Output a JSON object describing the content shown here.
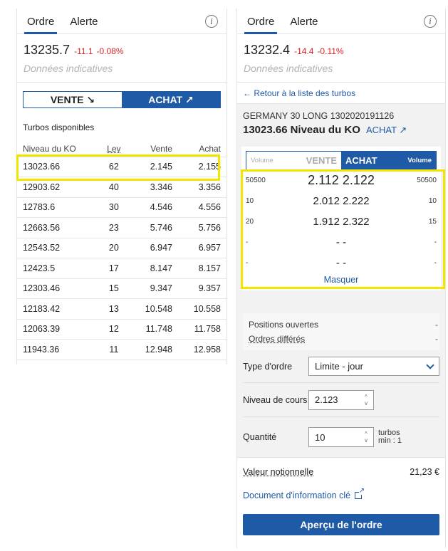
{
  "left": {
    "tabs": [
      "Ordre",
      "Alerte"
    ],
    "info_icon": "info-icon",
    "price": "13235.7",
    "change": "-11.1",
    "change_pct": "-0.08%",
    "indicative": "Données indicatives",
    "sell_label": "VENTE ↘",
    "buy_label": "ACHAT ↗",
    "section_title": "Turbos disponibles",
    "columns": [
      "Niveau du KO",
      "Lev",
      "Vente",
      "Achat"
    ],
    "rows": [
      [
        "13023.66",
        "62",
        "2.145",
        "2.155"
      ],
      [
        "12903.62",
        "40",
        "3.346",
        "3.356"
      ],
      [
        "12783.6",
        "30",
        "4.546",
        "4.556"
      ],
      [
        "12663.56",
        "23",
        "5.746",
        "5.756"
      ],
      [
        "12543.52",
        "20",
        "6.947",
        "6.957"
      ],
      [
        "12423.5",
        "17",
        "8.147",
        "8.157"
      ],
      [
        "12303.46",
        "15",
        "9.347",
        "9.357"
      ],
      [
        "12183.42",
        "13",
        "10.548",
        "10.558"
      ],
      [
        "12063.39",
        "12",
        "11.748",
        "11.758"
      ],
      [
        "11943.36",
        "11",
        "12.948",
        "12.958"
      ]
    ]
  },
  "right": {
    "tabs": [
      "Ordre",
      "Alerte"
    ],
    "price": "13232.4",
    "change": "-14.4",
    "change_pct": "-0.11%",
    "indicative": "Données indicatives",
    "back_link": "← Retour à la liste des turbos",
    "instrument_name": "GERMANY 30 LONG 1302020191126",
    "ko_value": "13023.66",
    "ko_label": "Niveau du KO",
    "achat_link": "ACHAT ↗",
    "book": {
      "sell_volume_label": "Volume",
      "sell_label": "VENTE",
      "buy_label": "ACHAT",
      "buy_volume_label": "Volume",
      "rows": [
        {
          "bid_vol": "50500",
          "prices": "2.112 2.122",
          "ask_vol": "50500"
        },
        {
          "bid_vol": "10",
          "prices": "2.012 2.222",
          "ask_vol": "10"
        },
        {
          "bid_vol": "20",
          "prices": "1.912 2.322",
          "ask_vol": "15"
        },
        {
          "bid_vol": "-",
          "prices": "- -",
          "ask_vol": "-"
        },
        {
          "bid_vol": "-",
          "prices": "- -",
          "ask_vol": "-"
        }
      ],
      "hide_label": "Masquer"
    },
    "positions": [
      {
        "label": "Positions ouvertes",
        "value": "-"
      },
      {
        "label": "Ordres différés",
        "value": "-"
      }
    ],
    "order_type_label": "Type d'ordre",
    "order_type_value": "Limite - jour",
    "price_level_label": "Niveau de cours",
    "price_level_value": "2.123",
    "quantity_label": "Quantité",
    "quantity_value": "10",
    "quantity_unit": "turbos",
    "quantity_min": "min : 1",
    "notional_label": "Valeur notionnelle",
    "notional_value": "21,23 €",
    "doc_link": "Document d'information clé",
    "preview_button": "Aperçu de l'ordre"
  },
  "colors": {
    "accent": "#1f5aa6",
    "negative": "#d8232a",
    "highlight": "#f2e600"
  }
}
